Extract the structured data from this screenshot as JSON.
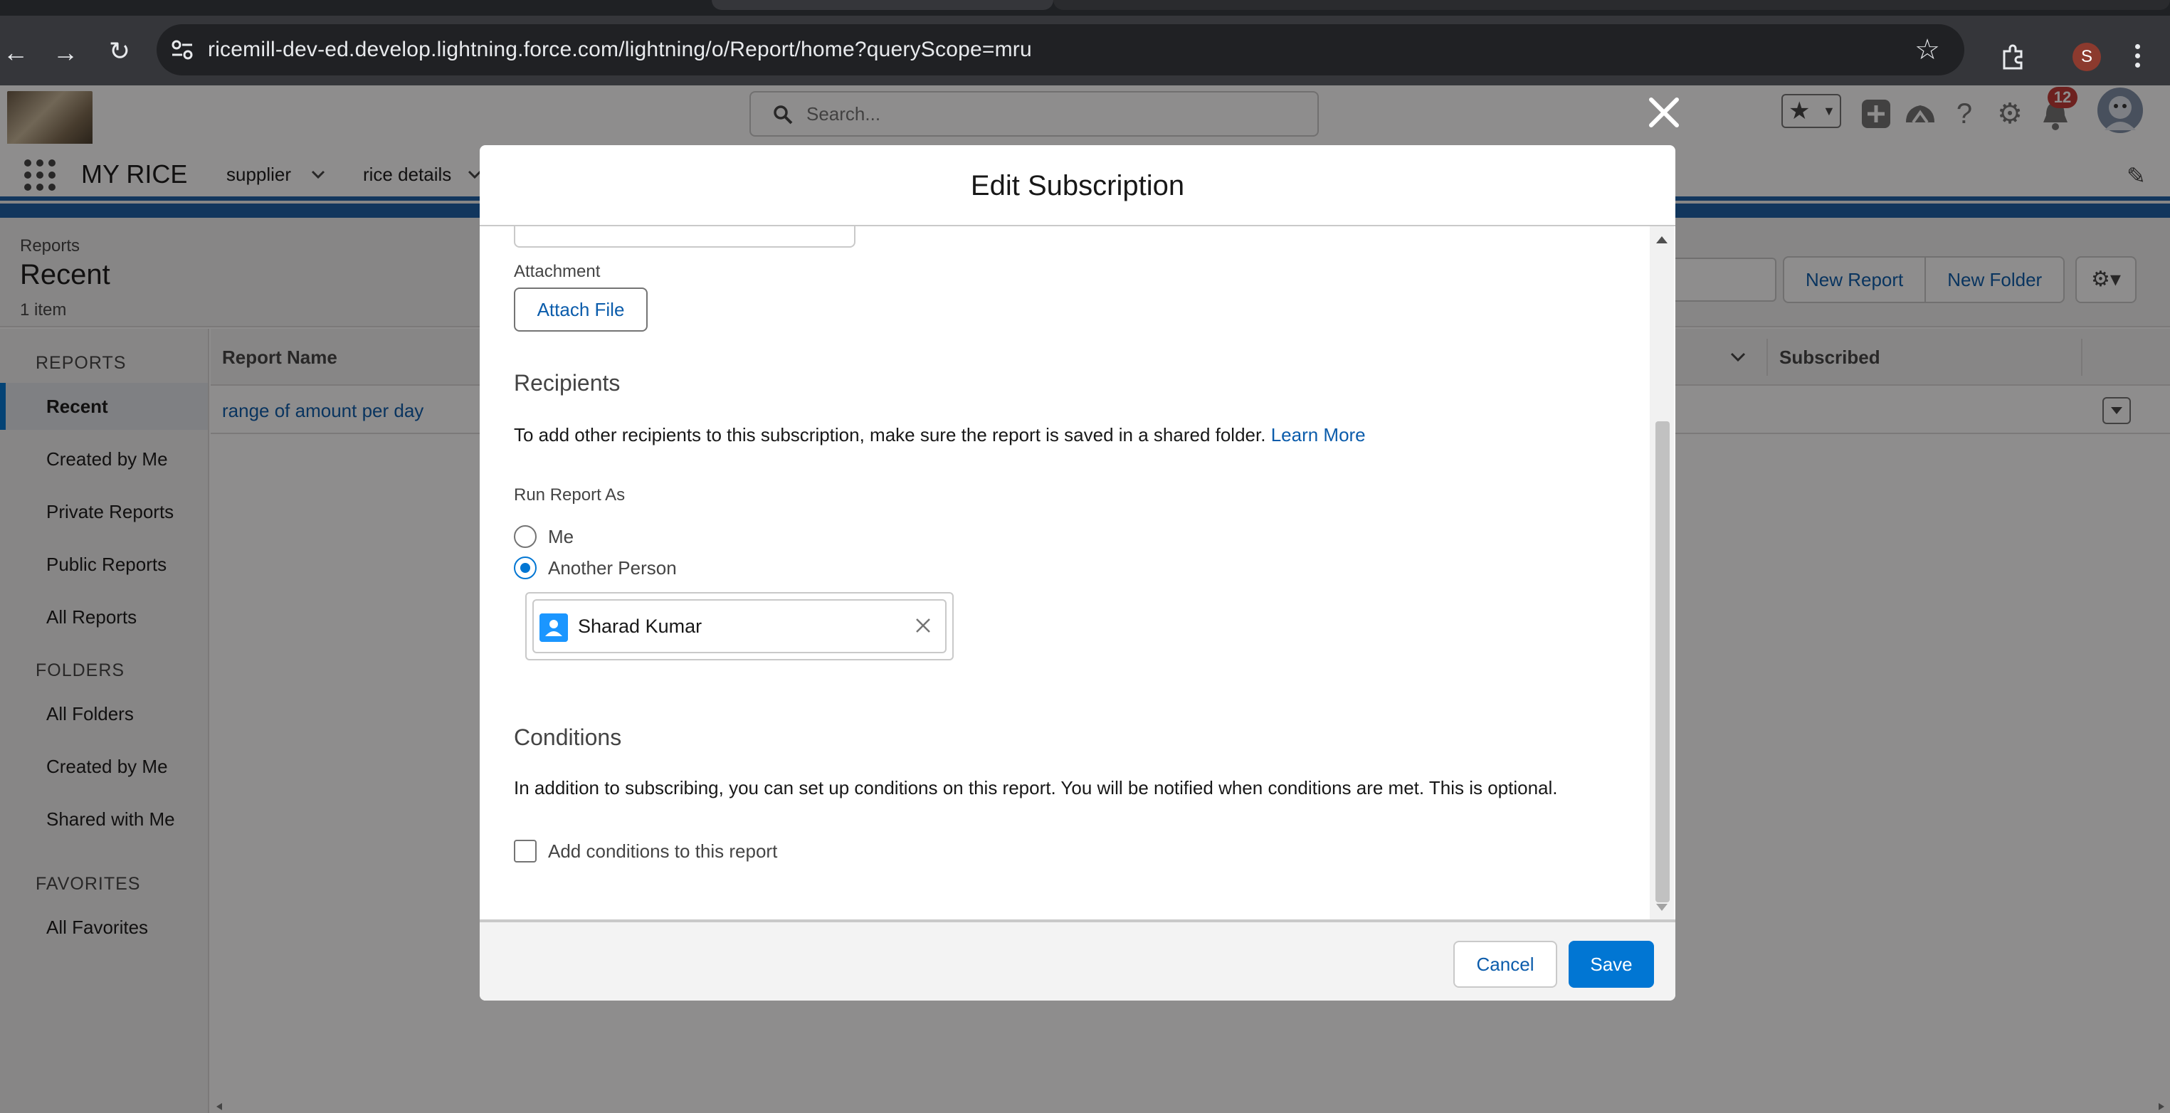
{
  "browser": {
    "url": "ricemill-dev-ed.develop.lightning.force.com/lightning/o/Report/home?queryScope=mru",
    "profile_initial": "S"
  },
  "app": {
    "name": "MY RICE",
    "search_placeholder": "Search...",
    "notification_count": "12",
    "nav_items": [
      {
        "label": "supplier"
      },
      {
        "label": "rice details"
      }
    ]
  },
  "page": {
    "kicker": "Reports",
    "title": "Recent",
    "count": "1 item",
    "new_report_label": "New Report",
    "new_folder_label": "New Folder"
  },
  "sidebar": {
    "sections": [
      {
        "title": "REPORTS",
        "items": [
          "Recent",
          "Created by Me",
          "Private Reports",
          "Public Reports",
          "All Reports"
        ]
      },
      {
        "title": "FOLDERS",
        "items": [
          "All Folders",
          "Created by Me",
          "Shared with Me"
        ]
      },
      {
        "title": "FAVORITES",
        "items": [
          "All Favorites"
        ]
      }
    ]
  },
  "table": {
    "columns": [
      "Report Name",
      "Subscribed"
    ],
    "rows": [
      {
        "report_name": "range of amount per day"
      }
    ]
  },
  "modal": {
    "title": "Edit Subscription",
    "attachment_label": "Attachment",
    "attach_button": "Attach File",
    "recipients_title": "Recipients",
    "recipients_text": "To add other recipients to this subscription, make sure the report is saved in a shared folder.",
    "learn_more": "Learn More",
    "run_as_label": "Run Report As",
    "run_as_options": [
      {
        "label": "Me",
        "selected": false
      },
      {
        "label": "Another Person",
        "selected": true
      }
    ],
    "selected_person": "Sharad Kumar",
    "conditions_title": "Conditions",
    "conditions_text": "In addition to subscribing, you can set up conditions on this report. You will be notified when conditions are met. This is optional.",
    "add_conditions_label": "Add conditions to this report",
    "add_conditions_checked": false,
    "cancel_label": "Cancel",
    "save_label": "Save"
  },
  "colors": {
    "brand_blue": "#0176d3",
    "link_blue": "#0b5cab",
    "header_band": "#1b5fa6",
    "badge_red": "#c23934"
  },
  "icons": [
    "back-icon",
    "forward-icon",
    "reload-icon",
    "site-settings-icon",
    "bookmark-star-icon",
    "extensions-icon",
    "kebab-menu-icon",
    "search-icon",
    "favorites-star-icon",
    "add-icon",
    "trailhead-icon",
    "help-icon",
    "setup-gear-icon",
    "notification-bell-icon",
    "close-icon",
    "user-icon",
    "clear-icon"
  ]
}
